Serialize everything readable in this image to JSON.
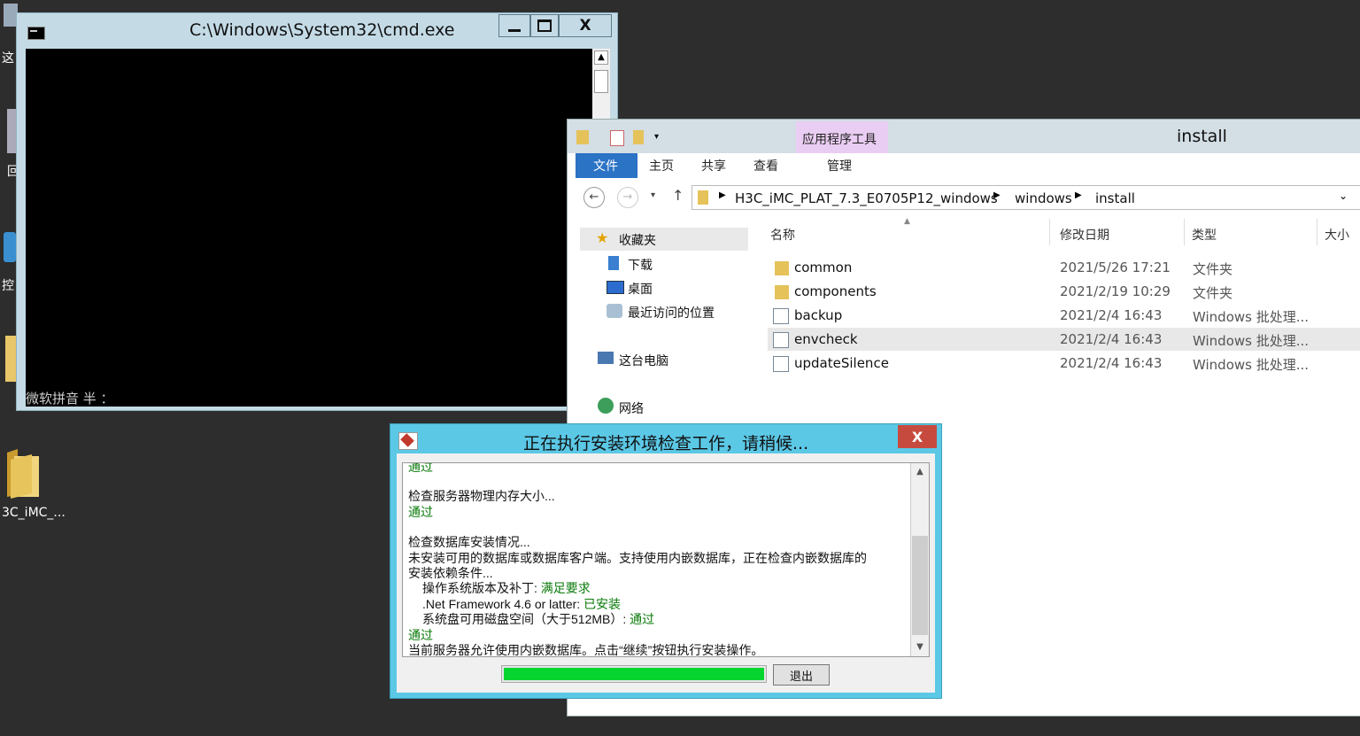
{
  "desktop": {
    "icons": [
      {
        "label": "这"
      },
      {
        "label": "回"
      },
      {
        "label": "控"
      },
      {
        "label": "3C_iMC_..."
      }
    ]
  },
  "cmd": {
    "title": "C:\\Windows\\System32\\cmd.exe",
    "ime_status": "微软拼音 半 ：",
    "minimize": "—",
    "close": "X"
  },
  "explorer": {
    "title": "install",
    "context_tab": "应用程序工具",
    "ribbon_tabs": [
      "文件",
      "主页",
      "共享",
      "查看",
      "管理"
    ],
    "breadcrumb": [
      "H3C_iMC_PLAT_7.3_E0705P12_windows",
      "windows",
      "install"
    ],
    "nav": {
      "favorites": "收藏夹",
      "downloads": "下载",
      "desktop": "桌面",
      "recent": "最近访问的位置",
      "this_pc": "这台电脑",
      "network": "网络"
    },
    "columns": [
      "名称",
      "修改日期",
      "类型",
      "大小"
    ],
    "files": [
      {
        "name": "common",
        "date": "2021/5/26 17:21",
        "type": "文件夹",
        "icon": "folder-icon"
      },
      {
        "name": "components",
        "date": "2021/2/19 10:29",
        "type": "文件夹",
        "icon": "folder-icon"
      },
      {
        "name": "backup",
        "date": "2021/2/4 16:43",
        "type": "Windows 批处理...",
        "icon": "batch-file-icon"
      },
      {
        "name": "envcheck",
        "date": "2021/2/4 16:43",
        "type": "Windows 批处理...",
        "icon": "batch-file-icon",
        "selected": true
      },
      {
        "name": "updateSilence",
        "date": "2021/2/4 16:43",
        "type": "Windows 批处理...",
        "icon": "batch-file-icon"
      }
    ]
  },
  "dialog": {
    "title": "正在执行安装环境检查工作，请稍候...",
    "close": "X",
    "log": [
      {
        "text": "通过",
        "ok": true
      },
      {
        "text": "检查服务器物理内存大小...",
        "ok": false
      },
      {
        "text": "通过",
        "ok": true
      },
      {
        "text": "检查数据库安装情况...",
        "ok": false
      },
      {
        "text": "未安装可用的数据库或数据库客户端。支持使用内嵌数据库，正在检查内嵌数据库的",
        "ok": false
      },
      {
        "text": "安装依赖条件...",
        "ok": false
      },
      {
        "text": "操作系统版本及补丁: ",
        "status": "满足要求"
      },
      {
        "text": ".Net Framework 4.6 or latter: ",
        "status": "已安装"
      },
      {
        "text": "系统盘可用磁盘空间（大于512MB）: ",
        "status": "通过"
      },
      {
        "text": "通过",
        "ok": true
      },
      {
        "text": "当前服务器允许使用内嵌数据库。点击“继续”按钮执行安装操作。",
        "ok": false
      }
    ],
    "progress": 1.0,
    "exit_button": "退出"
  },
  "colors": {
    "dialog_frame": "#5bc8e6",
    "progress_fill": "#06d52f",
    "ok_text": "#0a7a0a",
    "file_tab": "#2b73c5",
    "context_tab_bg": "#eacdf2"
  }
}
